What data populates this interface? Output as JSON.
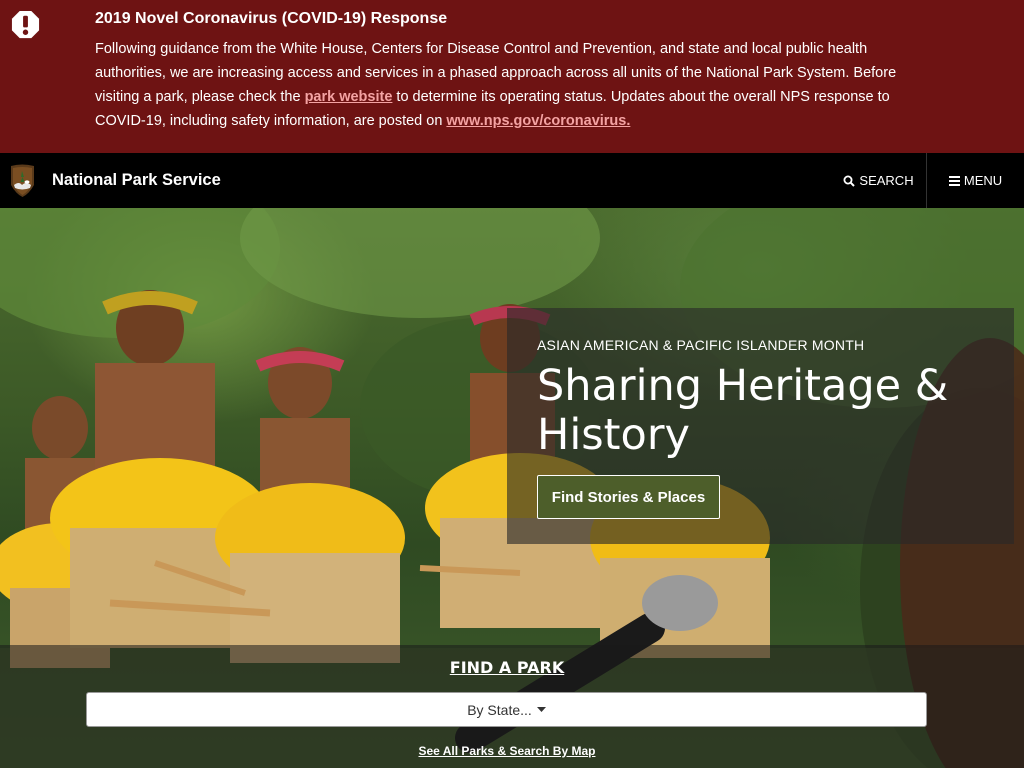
{
  "alert": {
    "icon": "exclamation-icon",
    "title": "2019 Novel Coronavirus (COVID-19) Response",
    "body_part1": "Following guidance from the White House, Centers for Disease Control and Prevention, and state and local public health authorities, we are increasing access and services in a phased approach across all units of the National Park System. Before visiting a park, please check the ",
    "link1": "park website",
    "body_part2": " to determine its operating status. Updates about the overall NPS response to COVID-19, including safety information, are posted on ",
    "link2": "www.nps.gov/coronavirus.",
    "background": "#6e1313"
  },
  "navbar": {
    "logo": "nps-arrowhead-logo",
    "site_name": "National Park Service",
    "search_label": "SEARCH",
    "menu_label": "MENU"
  },
  "hero": {
    "kicker": "ASIAN AMERICAN & PACIFIC ISLANDER MONTH",
    "headline": "Sharing Heritage & History",
    "cta_label": "Find Stories & Places",
    "cta_color": "#4d5e2a"
  },
  "find_park": {
    "title": "FIND A PARK",
    "select_value": "By State...",
    "see_all_link": "See All Parks & Search By Map"
  }
}
